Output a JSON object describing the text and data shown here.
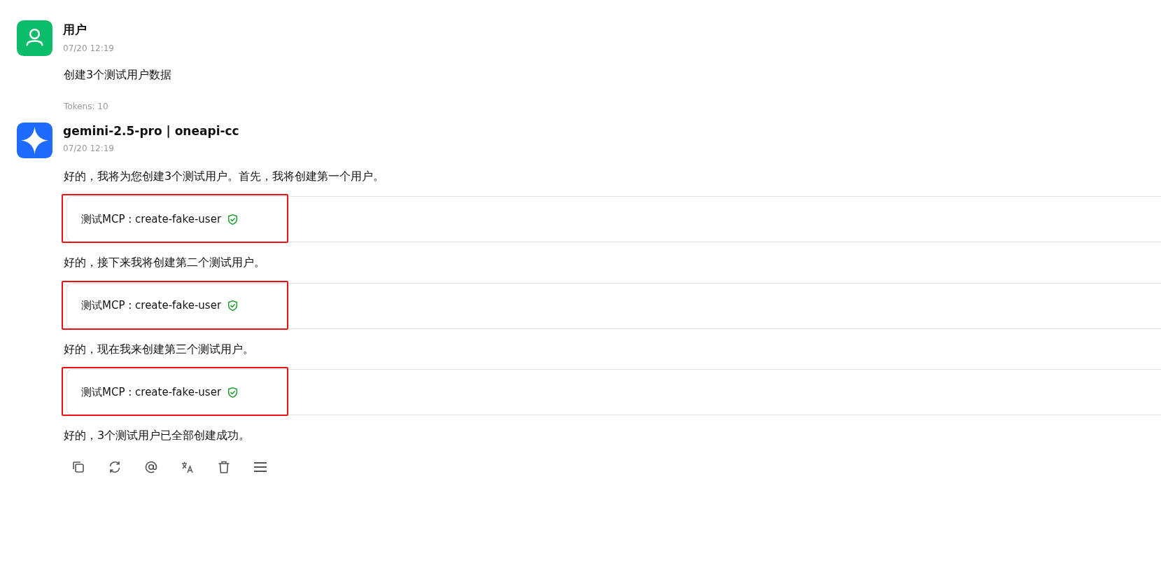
{
  "messages": [
    {
      "kind": "user",
      "name": "用户",
      "time": "07/20 12:19",
      "blocks": [
        {
          "kind": "text",
          "text": "创建3个测试用户数据"
        }
      ],
      "tokens": "Tokens: 10"
    },
    {
      "kind": "assistant",
      "name": "gemini-2.5-pro | oneapi-cc",
      "time": "07/20 12:19",
      "blocks": [
        {
          "kind": "text",
          "text": "好的，我将为您创建3个测试用户。首先，我将创建第一个用户。"
        },
        {
          "kind": "tool",
          "server": "测试MCP",
          "separator": ":",
          "tool": "create-fake-user",
          "highlighted": true
        },
        {
          "kind": "text",
          "text": "好的，接下来我将创建第二个测试用户。"
        },
        {
          "kind": "tool",
          "server": "测试MCP",
          "separator": ":",
          "tool": "create-fake-user",
          "highlighted": true
        },
        {
          "kind": "text",
          "text": "好的，现在我来创建第三个测试用户。"
        },
        {
          "kind": "tool",
          "server": "测试MCP",
          "separator": ":",
          "tool": "create-fake-user",
          "highlighted": true
        },
        {
          "kind": "text",
          "text": "好的，3个测试用户已全部创建成功。"
        }
      ]
    }
  ]
}
